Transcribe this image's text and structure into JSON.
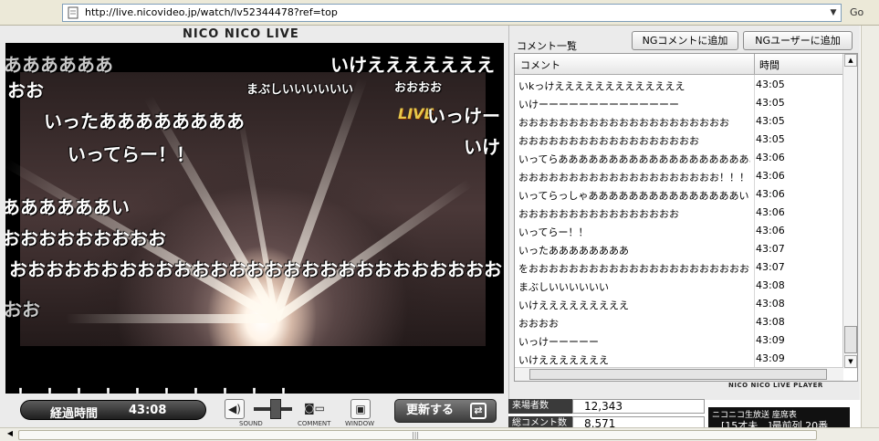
{
  "browser": {
    "url": "http://live.nicovideo.jp/watch/lv52344478?ref=top",
    "go_label": "Go"
  },
  "player": {
    "logo": "NICO NICO LIVE",
    "tv_logo": "LIVE",
    "overlay_comments": [
      {
        "text": "ああああああ",
        "size": "l",
        "gray": true
      },
      {
        "text": "おお",
        "size": "l",
        "gray": false
      },
      {
        "text": "いけえええええええ",
        "size": "l",
        "gray": false
      },
      {
        "text": "まぶしいいいいいい",
        "size": "s",
        "gray": false
      },
      {
        "text": "おおおお",
        "size": "s",
        "gray": false
      },
      {
        "text": "いったああああああああ",
        "size": "l",
        "gray": false
      },
      {
        "text": "いっけー",
        "size": "l",
        "gray": false
      },
      {
        "text": "いってらー！！",
        "size": "l",
        "gray": false
      },
      {
        "text": "いけ",
        "size": "l",
        "gray": false
      },
      {
        "text": "ああああああい",
        "size": "l",
        "gray": false
      },
      {
        "text": "おおおおおおおおお",
        "size": "l",
        "gray": false
      },
      {
        "text": "おおおおおおおおおおおおおおおおおおおおおおおおおおお",
        "size": "l",
        "gray": false
      },
      {
        "text": "おお",
        "size": "l",
        "gray": true
      }
    ],
    "exclaim_row": "！！！！！！！！！！"
  },
  "controls": {
    "elapsed_label": "経過時間",
    "elapsed_time": "43:08",
    "sound_label": "SOUND",
    "comment_label": "COMMENT",
    "window_label": "WINDOW",
    "refresh_label": "更新する"
  },
  "comment_panel": {
    "title": "コメント一覧",
    "ng_comment_button": "NGコメントに追加",
    "ng_user_button": "NGユーザーに追加",
    "col_comment": "コメント",
    "col_time": "時間",
    "rows": [
      {
        "comment": "いkっけえええええええええええええ",
        "time": "43:05"
      },
      {
        "comment": "いけーーーーーーーーーーーーーー",
        "time": "43:05"
      },
      {
        "comment": "おおおおおおおおおおおおおおおおおおおおお",
        "time": "43:05"
      },
      {
        "comment": "おおおおおおおおおおおおおおおおおお",
        "time": "43:05"
      },
      {
        "comment": "いってらああああああああああああああああああああああああ",
        "time": "43:06"
      },
      {
        "comment": "おおおおおおおおおおおおおおおおおおおお！！！",
        "time": "43:06"
      },
      {
        "comment": "いってらっしゃあああああああああああああああい",
        "time": "43:06"
      },
      {
        "comment": "おおおおおおおおおおおおおおおお",
        "time": "43:06"
      },
      {
        "comment": "いってらー！！",
        "time": "43:06"
      },
      {
        "comment": "いったああああああああ",
        "time": "43:07"
      },
      {
        "comment": "をおおおおおおおおおおおおおおおおおおおおおおお",
        "time": "43:07"
      },
      {
        "comment": "まぶしいいいいいい",
        "time": "43:08"
      },
      {
        "comment": "いけえええええええええ",
        "time": "43:08"
      },
      {
        "comment": "おおおお",
        "time": "43:08"
      },
      {
        "comment": "いっけーーーーー",
        "time": "43:09"
      },
      {
        "comment": "いけえええええええ",
        "time": "43:09"
      }
    ],
    "footer": "NICO NICO LIVE PLAYER"
  },
  "stats": {
    "visitors_label": "来場者数",
    "visitors_value": "12,343",
    "comments_label": "総コメント数",
    "comments_value": "8,571"
  },
  "ticker": {
    "line1": "ニコニコ生放送 座席表",
    "line2": "[15才未…]最前列 20番"
  }
}
